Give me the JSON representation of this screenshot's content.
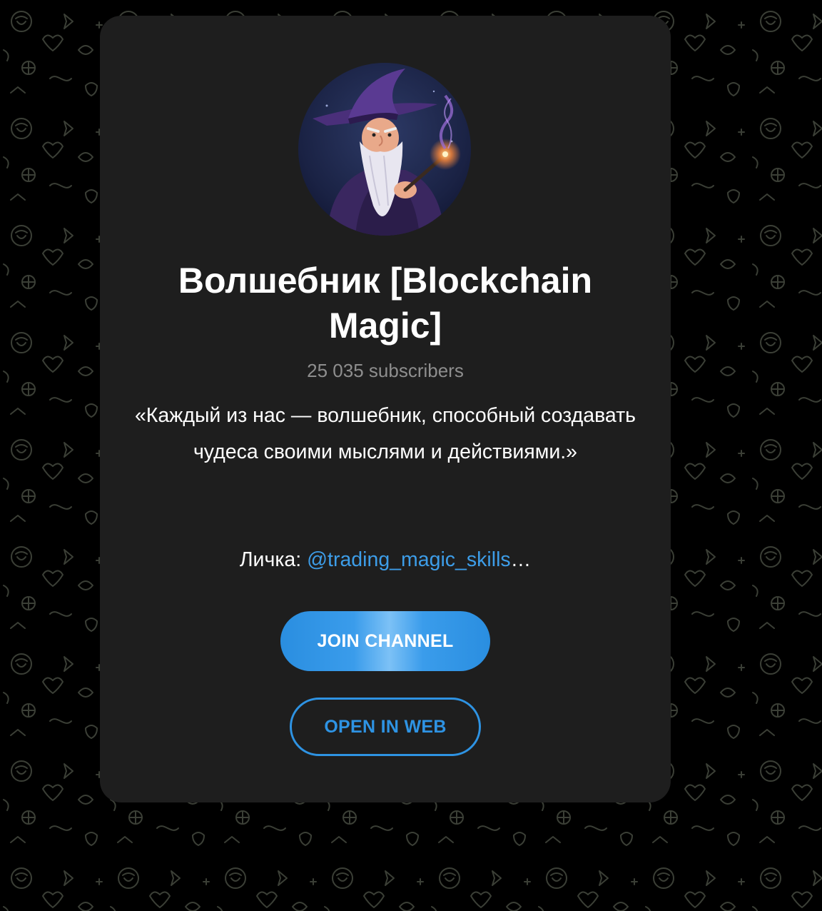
{
  "channel": {
    "title": "Волшебник [Blockchain Magic]",
    "subscribers": "25 035 subscribers",
    "description": "«Каждый из нас — волшебник, способный создавать чудеса своими мыслями и действиями.»",
    "contact_label": "Личка: ",
    "contact_link": "@trading_magic_skills",
    "contact_ellipsis": "…"
  },
  "buttons": {
    "join_label": "JOIN CHANNEL",
    "web_label": "OPEN IN WEB"
  },
  "colors": {
    "page_background": "#000000",
    "card_background": "#1e1e1e",
    "accent": "#2e93e3",
    "link": "#3d9de8",
    "subscribers_text": "#8e8e8e"
  },
  "icons": {
    "avatar": "wizard-avatar",
    "background": "doodle-pattern"
  }
}
